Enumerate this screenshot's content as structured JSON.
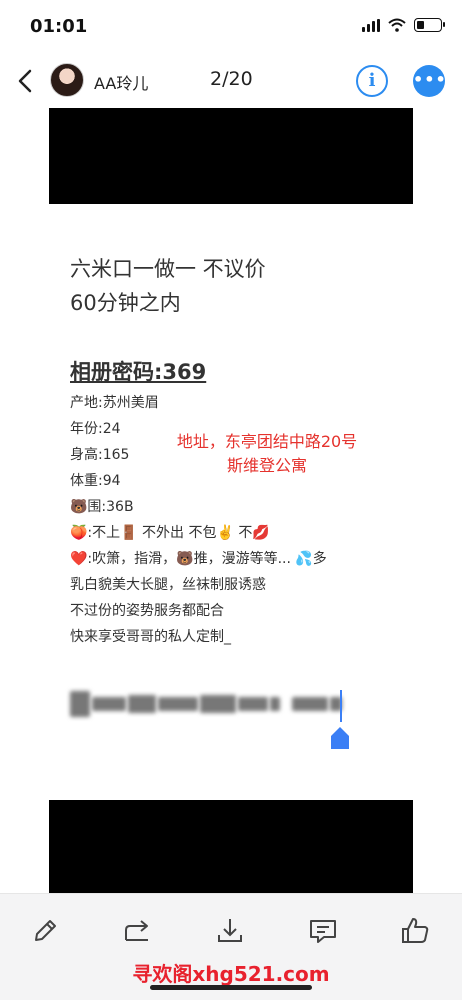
{
  "status": {
    "time": "01:01"
  },
  "nav": {
    "username": "AA玲儿",
    "page_counter": "2/20",
    "info_label": "i",
    "more_label": "•••"
  },
  "post": {
    "headline_line1": "六米口一做一  不议价",
    "headline_line2": "60分钟之内",
    "password_line": "相册密码:369",
    "details": [
      "产地:苏州美眉",
      "年份:24",
      "身高:165",
      "体重:94",
      "🐻围:36B",
      "🍑:不上🚪 不外出 不包✌️ 不💋",
      "❤️:吹箫，指滑，🐻推，漫游等等... 💦多",
      "乳白貌美大长腿，丝袜制服诱惑",
      "不过份的姿势服务都配合",
      "快来享受哥哥的私人定制_"
    ],
    "address_line1": "地址，东亭团结中路20号",
    "address_line2": "斯维登公寓"
  },
  "toolbar": {
    "icons": [
      "pencil-icon",
      "share-icon",
      "download-icon",
      "comment-icon",
      "thumbs-up-icon"
    ]
  },
  "watermark": "寻欢阁xhg521.com",
  "colors": {
    "accent": "#2c8cf0",
    "note_red": "#e5322d",
    "watermark_red": "#e8222e"
  }
}
